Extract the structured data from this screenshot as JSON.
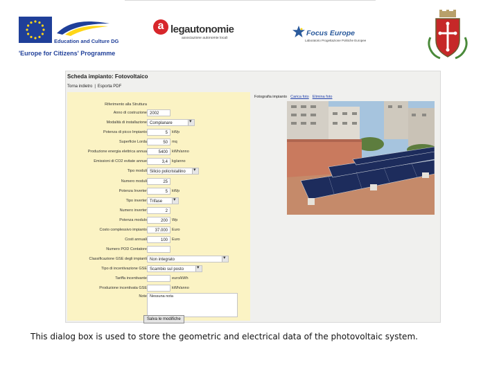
{
  "header": {
    "culture_text": "Education and Culture DG",
    "programme_text": "'Europe for Citizens' Programme",
    "lega_letter": "a",
    "lega_name": "legautonomie",
    "lega_subtitle": "associazione autonomie locali",
    "focus_name": "Focus Europe",
    "focus_subtitle": "Laboratorio Progettazione Politiche Europee"
  },
  "app": {
    "title": "Scheda impianto: Fotovoltaico",
    "menu": [
      "Torna indietro",
      "Esporta PDF"
    ],
    "photo_label": "Fotografia impianto",
    "photo_links": [
      "Carica foto",
      "Elimina foto"
    ],
    "save_label": "Salva le modifiche",
    "fields": [
      {
        "label": "Riferimento alla Struttura",
        "value": "",
        "type": "text",
        "width": 0
      },
      {
        "label": "Anno di costruzione",
        "value": "2002",
        "type": "text"
      },
      {
        "label": "Modalità di installazione",
        "value": "Complanare",
        "type": "select"
      },
      {
        "label": "Potenza di picco Impianto",
        "value": "5",
        "unit": "kWp",
        "type": "text"
      },
      {
        "label": "Superficie Lorda",
        "value": "50",
        "unit": "mq",
        "type": "text"
      },
      {
        "label": "Produzione energia elettrica annua",
        "value": "5400",
        "unit": "kWh/anno",
        "type": "text"
      },
      {
        "label": "Emissioni di CO2 evitate annue",
        "value": "3,4",
        "unit": "kg/anno",
        "type": "text"
      },
      {
        "label": "Tipo moduli",
        "value": "Silicio policristallino",
        "type": "select"
      },
      {
        "label": "Numero moduli",
        "value": "25",
        "type": "text"
      },
      {
        "label": "Potenza Inverter",
        "value": "5",
        "unit": "kWp",
        "type": "text"
      },
      {
        "label": "Tipo inverter",
        "value": "Trifase",
        "type": "select"
      },
      {
        "label": "Numero inverter",
        "value": "2",
        "type": "text"
      },
      {
        "label": "Potenza modulo",
        "value": "200",
        "unit": "Wp",
        "type": "text"
      },
      {
        "label": "Costo complessivo impianto",
        "value": "37.000",
        "unit": "Euro",
        "type": "text"
      },
      {
        "label": "Costi annuali",
        "value": "100",
        "unit": "Euro",
        "type": "text"
      },
      {
        "label": "Numero POD Contatore",
        "value": "",
        "type": "text"
      },
      {
        "label": "Classificazione GSE degli impianti",
        "value": "Non integrato",
        "type": "select"
      },
      {
        "label": "Tipo di incentivazione GSE",
        "value": "Scambio sul posto",
        "type": "select"
      },
      {
        "label": "Tariffa incentivante",
        "value": "",
        "unit": "euro/kWh",
        "type": "text"
      },
      {
        "label": "Produzione incentivata GSE",
        "value": "",
        "unit": "kWh/anno",
        "type": "text"
      },
      {
        "label": "Note",
        "value": "Nessuna nota",
        "type": "textarea"
      }
    ]
  },
  "caption": "This dialog box is used to store the geometric and electrical data of the photovoltaic system.",
  "colors": {
    "form_background": "#fbf3c4",
    "eu_blue": "#1f3f99",
    "lega_red": "#d7262b",
    "focus_blue": "#2a5a9c"
  }
}
